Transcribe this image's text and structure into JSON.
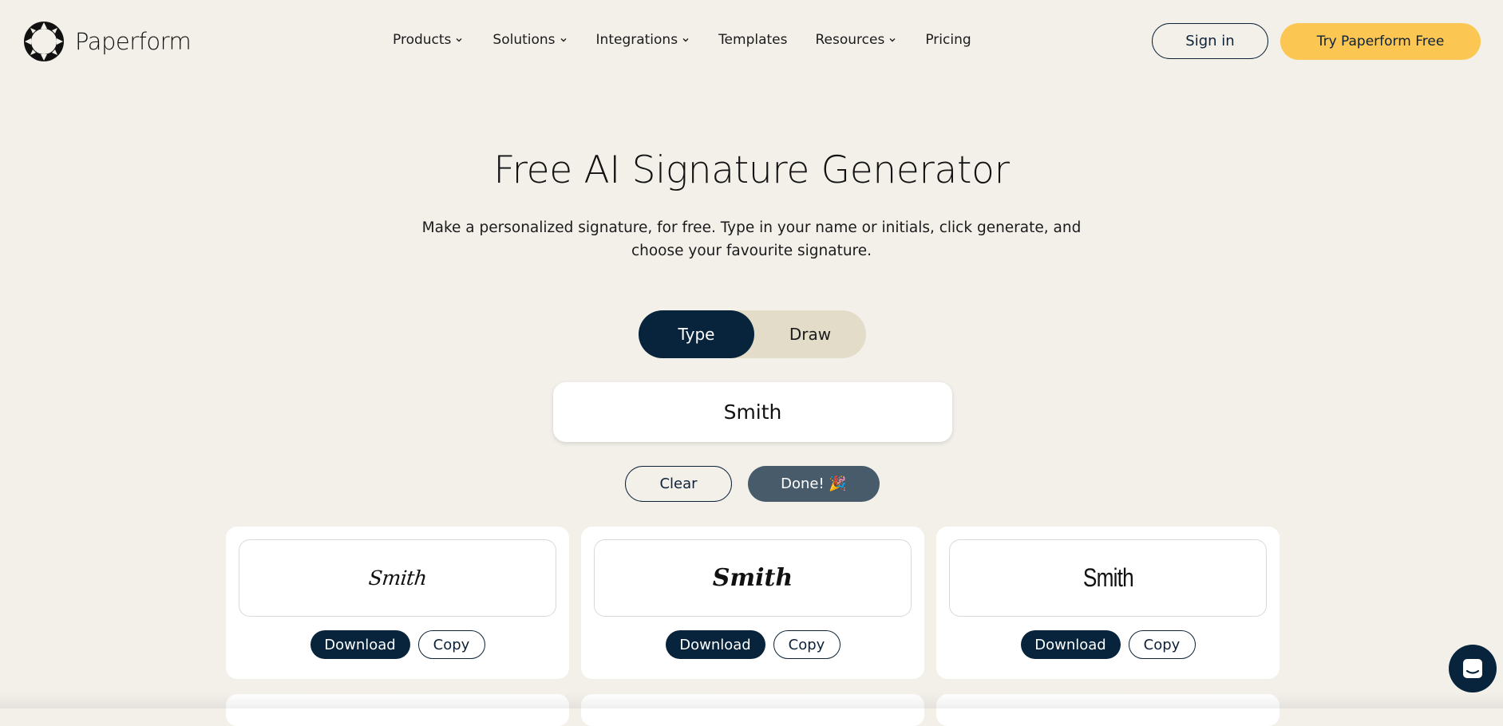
{
  "brand": {
    "name": "Paperform"
  },
  "nav": {
    "items": [
      {
        "label": "Products",
        "has_dropdown": true
      },
      {
        "label": "Solutions",
        "has_dropdown": true
      },
      {
        "label": "Integrations",
        "has_dropdown": true
      },
      {
        "label": "Templates",
        "has_dropdown": false
      },
      {
        "label": "Resources",
        "has_dropdown": true
      },
      {
        "label": "Pricing",
        "has_dropdown": false
      }
    ],
    "signin_label": "Sign in",
    "try_label": "Try Paperform Free"
  },
  "hero": {
    "title": "Free AI Signature Generator",
    "subtitle": "Make a personalized signature, for free. Type in your name or initials, click generate, and choose your favourite signature."
  },
  "mode_toggle": {
    "options": [
      "Type",
      "Draw"
    ],
    "selected": "Type"
  },
  "signature_input": {
    "value": "Smith"
  },
  "actions": {
    "clear_label": "Clear",
    "done_label": "Done! 🎉"
  },
  "signatures": [
    {
      "text": "Smith",
      "download_label": "Download",
      "copy_label": "Copy"
    },
    {
      "text": "Smith",
      "download_label": "Download",
      "copy_label": "Copy"
    },
    {
      "text": "Smith",
      "download_label": "Download",
      "copy_label": "Copy"
    }
  ],
  "icons": {
    "logo": "paperform-logo-icon",
    "dropdown": "chevron-down-icon",
    "chat": "chat-icon"
  },
  "colors": {
    "background": "#f3f0ea",
    "primary": "#08243c",
    "accent": "#fcc653",
    "toggle_bg": "#e3dcc8",
    "done_button": "#475b6b"
  }
}
